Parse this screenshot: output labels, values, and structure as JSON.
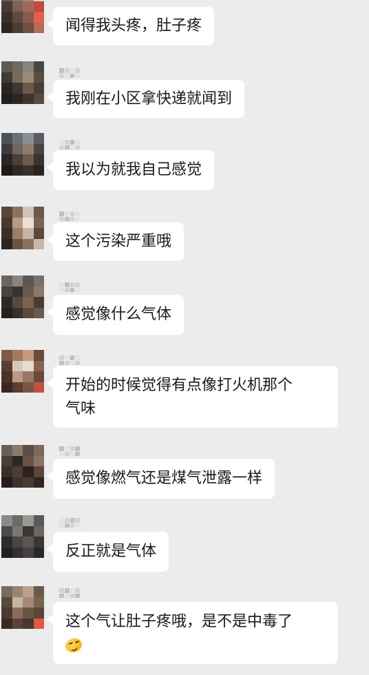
{
  "messages": [
    {
      "text": "闻得我头疼，肚子疼"
    },
    {
      "text": "我刚在小区拿快递就闻到"
    },
    {
      "text": "我以为就我自己感觉"
    },
    {
      "text": "这个污染严重哦"
    },
    {
      "text": "感觉像什么气体"
    },
    {
      "line1": "开始的时候觉得有点像打火机那个",
      "line2": "气味"
    },
    {
      "text": "感觉像燃气还是煤气泄露一样"
    },
    {
      "text": "反正就是气体"
    },
    {
      "line1": "这个气让肚子疼哦，是不是中毒了",
      "emoji": "laugh-cry-emoji"
    }
  ]
}
